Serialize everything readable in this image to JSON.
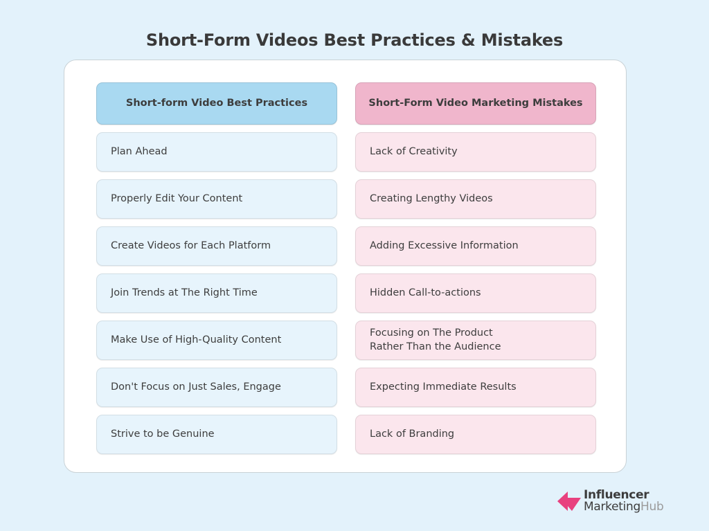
{
  "page": {
    "title": "Short-Form Videos Best Practices & Mistakes",
    "background_color": "#e3f2fb",
    "card_color": "#ffffff"
  },
  "columns": [
    {
      "key": "best_practices",
      "header": "Short-form Video Best Practices",
      "header_color": "#a9d9f1",
      "item_color": "#e7f4fc",
      "items": [
        "Plan Ahead",
        "Properly Edit Your Content",
        "Create Videos for Each Platform",
        "Join Trends at The Right Time",
        "Make Use of High-Quality Content",
        "Don't Focus on Just Sales, Engage",
        "Strive to be Genuine"
      ]
    },
    {
      "key": "mistakes",
      "header": "Short-Form Video Marketing Mistakes",
      "header_color": "#f0b6cc",
      "item_color": "#fbe6ed",
      "items": [
        "Lack of Creativity",
        "Creating Lengthy Videos",
        "Adding Excessive Information",
        "Hidden Call-to-actions",
        "Focusing on The Product\nRather Than the Audience",
        "Expecting Immediate Results",
        "Lack of Branding"
      ]
    }
  ],
  "logo": {
    "line1": "Influencer",
    "line2_dark": "Marketing",
    "line2_light": "Hub",
    "mark_color": "#e8417f"
  }
}
